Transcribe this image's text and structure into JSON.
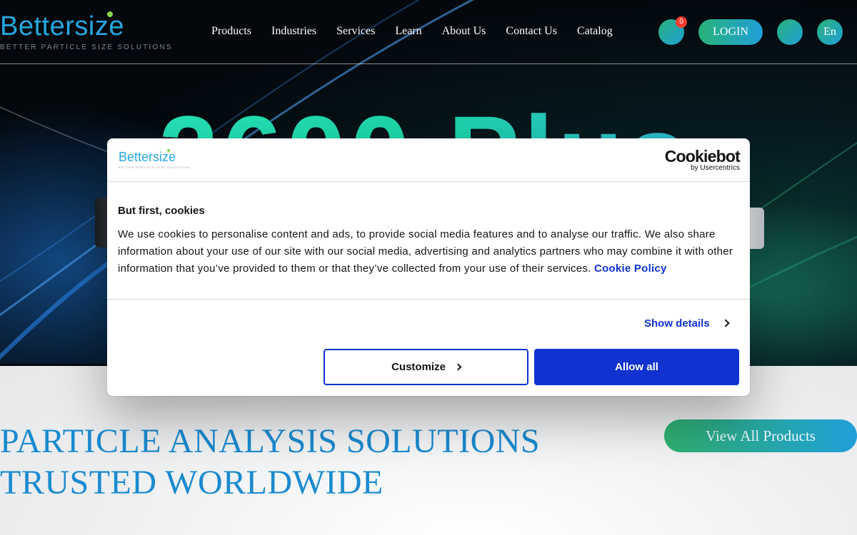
{
  "header": {
    "logo_text": "Bettersize",
    "logo_tagline": "BETTER PARTICLE SIZE SOLUTIONS",
    "nav": [
      {
        "label": "Products"
      },
      {
        "label": "Industries"
      },
      {
        "label": "Services"
      },
      {
        "label": "Learn"
      },
      {
        "label": "About Us"
      },
      {
        "label": "Contact Us"
      },
      {
        "label": "Catalog"
      }
    ],
    "cart_count": "0",
    "login_label": "LOGIN",
    "language_label": "En"
  },
  "hero": {
    "title_visible": "2600 Plus"
  },
  "main": {
    "headline_line1": "PARTICLE ANALYSIS SOLUTIONS",
    "headline_line2": "TRUSTED WORLDWIDE",
    "view_all_label": "View All Products"
  },
  "cookie_dialog": {
    "logo_text": "Bettersize",
    "logo_tagline": "BETTER PARTICLE SIZE SOLUTIONS",
    "brand": "Cookiebot",
    "brand_sub": "by Usercentrics",
    "title": "But first, cookies",
    "body": "We use cookies to personalise content and ads, to provide social media features and to analyse our traffic. We also share information about your use of our site with our social media, advertising and analytics partners who may combine it with other information that you’ve provided to them or that they’ve collected from your use of their services.",
    "policy_link": "Cookie Policy",
    "show_details": "Show details",
    "customize": "Customize",
    "allow_all": "Allow all"
  },
  "colors": {
    "brand_blue": "#27a7e0",
    "cookiebot_blue": "#1032cf",
    "accent_green": "#29b27a",
    "badge_red": "#ff3b30"
  }
}
